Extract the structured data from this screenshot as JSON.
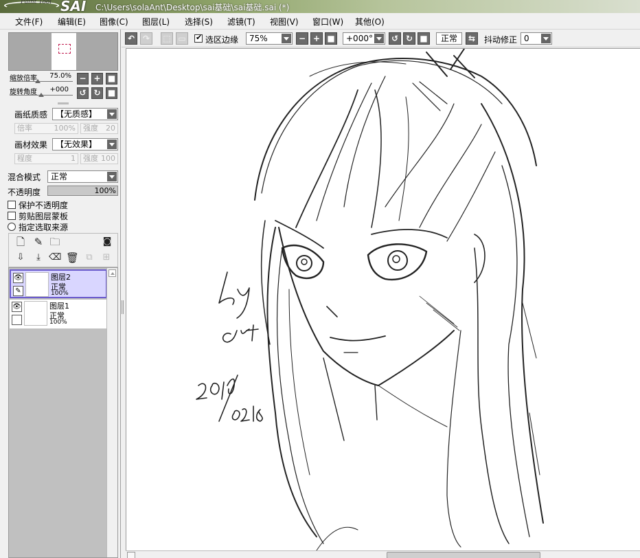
{
  "window": {
    "title": "C:\\Users\\solaAnt\\Desktop\\sai基础\\sai基础.sai (*)",
    "logo_small": "Paint Tool",
    "logo_big": "SAI"
  },
  "menu": [
    {
      "label": "文件(F)"
    },
    {
      "label": "编辑(E)"
    },
    {
      "label": "图像(C)"
    },
    {
      "label": "图层(L)"
    },
    {
      "label": "选择(S)"
    },
    {
      "label": "滤镜(T)"
    },
    {
      "label": "视图(V)"
    },
    {
      "label": "窗口(W)"
    },
    {
      "label": "其他(O)"
    }
  ],
  "navigator": {
    "zoom_label": "缩放倍率",
    "zoom_value": "75.0%",
    "rotate_label": "旋转角度",
    "rotate_value": "+000"
  },
  "paper": {
    "texture_label": "画纸质感",
    "texture_value": "【无质感】",
    "scale_label": "倍率",
    "scale_value": "100%",
    "strength_label": "强度",
    "strength_value": "20",
    "effect_label": "画材效果",
    "effect_value": "【无效果】",
    "degree_label": "程度",
    "degree_value": "1",
    "effect_strength_label": "强度",
    "effect_strength_value": "100"
  },
  "layer_props": {
    "blend_label": "混合模式",
    "blend_value": "正常",
    "opacity_label": "不透明度",
    "opacity_value": "100%",
    "preserve_opacity": "保护不透明度",
    "clipping": "剪贴图层蒙板",
    "selection_source": "指定选取来源"
  },
  "layers": [
    {
      "name": "图层2",
      "mode": "正常",
      "opacity": "100%",
      "selected": true
    },
    {
      "name": "图层1",
      "mode": "正常",
      "opacity": "100%",
      "selected": false
    }
  ],
  "canvas_toolbar": {
    "selection_edge_label": "选区边缘",
    "zoom_value": "75%",
    "rotation_value": "+000°",
    "mode_label": "正常",
    "stabilizer_label": "抖动修正",
    "stabilizer_value": "0"
  },
  "artwork": {
    "signature_by": "by",
    "signature_name": "ant",
    "signature_date": "2016/0218"
  }
}
